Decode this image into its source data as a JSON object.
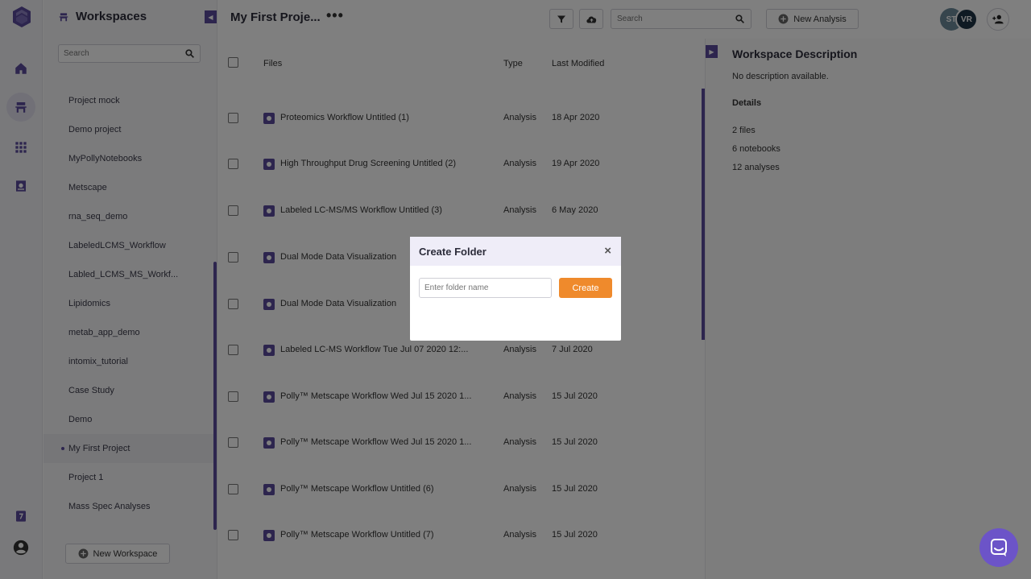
{
  "rail": {
    "items": [
      {
        "icon": "home-icon"
      },
      {
        "icon": "workspaces-icon",
        "active": true
      },
      {
        "icon": "apps-grid-icon"
      },
      {
        "icon": "notebook-icon"
      },
      {
        "icon": "help-icon"
      },
      {
        "icon": "account-icon"
      }
    ]
  },
  "sidebar": {
    "title": "Workspaces",
    "search_placeholder": "Search",
    "items": [
      {
        "label": "Project mock"
      },
      {
        "label": "Demo project"
      },
      {
        "label": "MyPollyNotebooks"
      },
      {
        "label": "Metscape"
      },
      {
        "label": "rna_seq_demo"
      },
      {
        "label": "LabeledLCMS_Workflow"
      },
      {
        "label": "Labled_LCMS_MS_Workf..."
      },
      {
        "label": "Lipidomics"
      },
      {
        "label": "metab_app_demo"
      },
      {
        "label": "intomix_tutorial"
      },
      {
        "label": "Case Study"
      },
      {
        "label": "Demo"
      },
      {
        "label": "My First Project",
        "active": true
      },
      {
        "label": "Project 1"
      },
      {
        "label": "Mass Spec Analyses"
      }
    ],
    "new_workspace_label": "New Workspace"
  },
  "header": {
    "project_title": "My First Proje...",
    "more_label": "•••",
    "search_placeholder": "Search",
    "new_analysis_label": "New Analysis",
    "avatars": [
      {
        "initials": "ST",
        "color": "#6c8a9a"
      },
      {
        "initials": "VR",
        "color": "#1f3546"
      }
    ]
  },
  "files": {
    "columns": {
      "name": "Files",
      "type": "Type",
      "modified": "Last Modified"
    },
    "rows": [
      {
        "name": "Proteomics Workflow Untitled (1)",
        "type": "Analysis",
        "date": "18 Apr 2020"
      },
      {
        "name": "High Throughput Drug Screening Untitled (2)",
        "type": "Analysis",
        "date": "19 Apr 2020"
      },
      {
        "name": "Labeled LC-MS/MS Workflow Untitled (3)",
        "type": "Analysis",
        "date": "6 May 2020"
      },
      {
        "name": "Dual Mode Data Visualization",
        "type": "",
        "date": ""
      },
      {
        "name": "Dual Mode Data Visualization",
        "type": "",
        "date": ""
      },
      {
        "name": "Labeled LC-MS Workflow Tue Jul 07 2020 12:...",
        "type": "Analysis",
        "date": "7 Jul 2020"
      },
      {
        "name": "Polly™ Metscape Workflow Wed Jul 15 2020 1...",
        "type": "Analysis",
        "date": "15 Jul 2020"
      },
      {
        "name": "Polly™ Metscape Workflow Wed Jul 15 2020 1...",
        "type": "Analysis",
        "date": "15 Jul 2020"
      },
      {
        "name": "Polly™ Metscape Workflow Untitled (6)",
        "type": "Analysis",
        "date": "15 Jul 2020"
      },
      {
        "name": "Polly™ Metscape Workflow Untitled (7)",
        "type": "Analysis",
        "date": "15 Jul 2020"
      }
    ]
  },
  "description": {
    "title": "Workspace Description",
    "text": "No description available.",
    "details_label": "Details",
    "stats": [
      "2 files",
      "6 notebooks",
      "12 analyses"
    ]
  },
  "modal": {
    "title": "Create Folder",
    "close_label": "×",
    "input_placeholder": "Enter folder name",
    "input_value": "",
    "create_label": "Create"
  },
  "colors": {
    "accent": "#5b4b9c",
    "create_button": "#ef8a2c",
    "chat_bubble": "#6c54c8"
  }
}
